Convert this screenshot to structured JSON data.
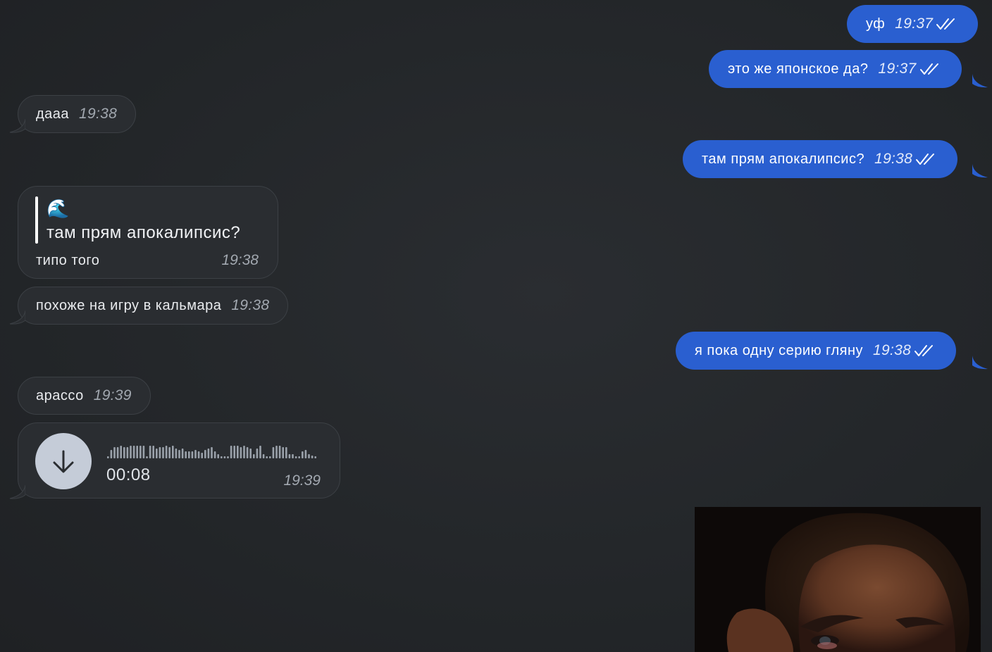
{
  "messages": {
    "m1": {
      "text": "уф",
      "time": "19:37"
    },
    "m2": {
      "text": "это же японское да?",
      "time": "19:37"
    },
    "m3": {
      "text": "дааа",
      "time": "19:38"
    },
    "m4": {
      "text": "там прям апокалипсис?",
      "time": "19:38"
    },
    "m5": {
      "quote_emoji": "🌊",
      "quote_text": "там прям апокалипсис?",
      "text": "типо того",
      "time": "19:38"
    },
    "m6": {
      "text": "похоже на игру в кальмара",
      "time": "19:38"
    },
    "m7": {
      "text": "я пока одну серию гляну",
      "time": "19:38"
    },
    "m8": {
      "text": "арассо",
      "time": "19:39"
    },
    "m9": {
      "duration": "00:08",
      "time": "19:39",
      "icon": "download-arrow-icon"
    }
  },
  "colors": {
    "background": "#24272b",
    "incoming_bubble": "#2a2d31",
    "outgoing_bubble": "#2a5fd0"
  }
}
